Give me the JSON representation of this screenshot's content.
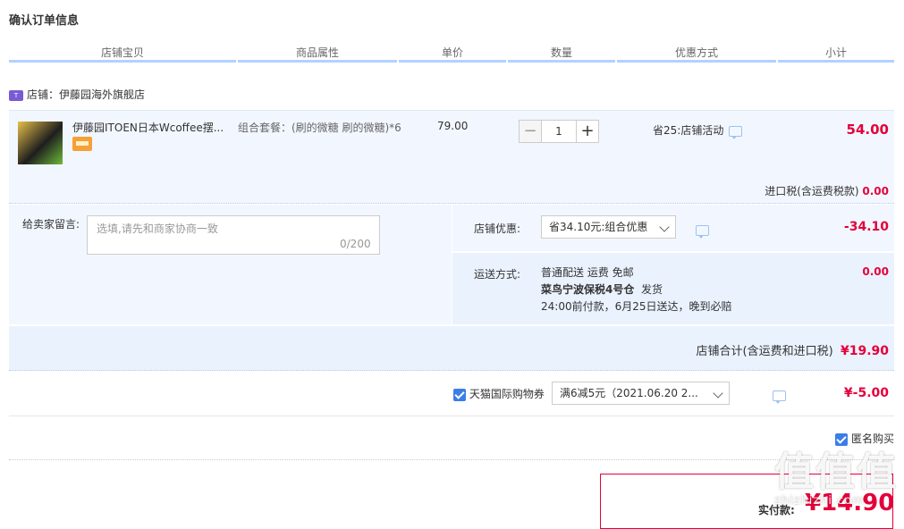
{
  "page": {
    "title": "确认订单信息"
  },
  "header": {
    "columns": [
      "店铺宝贝",
      "商品属性",
      "单价",
      "数量",
      "优惠方式",
      "小计"
    ]
  },
  "shop": {
    "name": "店铺：伊藤园海外旗舰店",
    "icon": "tmall-global-icon"
  },
  "item": {
    "name": "伊藤园ITOEN日本Wcoffee摆...",
    "attr": "组合套餐：(刷的微糖 刷的微糖)*6",
    "price": "79.00",
    "quantity": "1",
    "promo": "省25:店铺活动",
    "subtotal": "54.00"
  },
  "tax": {
    "label": "进口税(含运费税款)",
    "value": "0.00"
  },
  "message": {
    "label": "给卖家留言:",
    "placeholder": "选填,请先和商家协商一致",
    "count": "0/200"
  },
  "shop_discount": {
    "label": "店铺优惠:",
    "selected": "省34.10元:组合优惠",
    "value": "-34.10"
  },
  "shipping": {
    "label": "运送方式:",
    "line1": "普通配送 运费 免邮",
    "line2a": "菜鸟宁波保税4号仓",
    "line2b": "发货",
    "line3": "24:00前付款，6月25日送达，晚到必赔",
    "value": "0.00"
  },
  "shop_total": {
    "label": "店铺合计(含运费和进口税)",
    "value": "¥19.90"
  },
  "coupon": {
    "label": "天猫国际购物券",
    "selected": "满6减5元（2021.06.20 2...",
    "value": "¥-5.00"
  },
  "anonymous": {
    "label": "匿名购买"
  },
  "payment": {
    "label": "实付款:",
    "amount": "¥14.90"
  },
  "watermark": {
    "big": "值值值",
    "small": "zhizhizhi.com"
  },
  "colors": {
    "accent": "#e4003a",
    "blue": "#3c7ee8",
    "rowbg": "#f2f7ff"
  }
}
